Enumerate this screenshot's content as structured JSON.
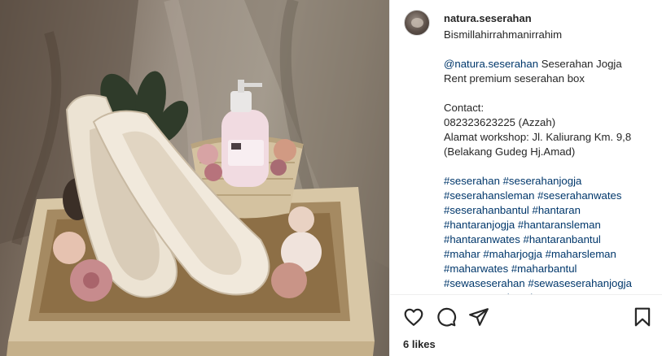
{
  "post": {
    "username": "natura.seserahan",
    "image_icon": "product-photo",
    "caption_lines": [
      {
        "text": "Bismillahirrahmanirrahim",
        "kind": "text"
      },
      {
        "text": "",
        "kind": "blank"
      },
      {
        "mention": "@natura.seserahan",
        "text": " Seserahan Jogja",
        "kind": "mention"
      },
      {
        "text": "Rent premium seserahan box",
        "kind": "text"
      },
      {
        "text": "",
        "kind": "blank"
      },
      {
        "text": "Contact:",
        "kind": "text"
      },
      {
        "text": "082323623225 (Azzah)",
        "kind": "text"
      },
      {
        "text": "Alamat workshop: Jl. Kaliurang Km. 9,8",
        "kind": "text"
      },
      {
        "text": "(Belakang Gudeg Hj.Amad)",
        "kind": "text"
      },
      {
        "text": "",
        "kind": "blank"
      },
      {
        "text": "#seserahan #seserahanjogja",
        "kind": "tag"
      },
      {
        "text": "#seserahansleman #seserahanwates",
        "kind": "tag"
      },
      {
        "text": "#seserahanbantul #hantaran",
        "kind": "tag"
      },
      {
        "text": "#hantaranjogja #hantaransleman",
        "kind": "tag"
      },
      {
        "text": "#hantaranwates #hantaranbantul",
        "kind": "tag"
      },
      {
        "text": "#mahar #maharjogja #maharsleman",
        "kind": "tag"
      },
      {
        "text": "#maharwates #maharbantul",
        "kind": "tag"
      },
      {
        "text": "#sewaseserahan #sewaseserahanjogja",
        "kind": "tag"
      },
      {
        "text": "#sewaseserahansleman",
        "kind": "tag"
      }
    ],
    "likes_text": "6 likes"
  },
  "actions": {
    "like_icon": "heart-icon",
    "comment_icon": "comment-icon",
    "share_icon": "share-icon",
    "save_icon": "bookmark-icon"
  },
  "colors": {
    "text": "#262626",
    "link": "#00376b",
    "divider": "#efefef"
  }
}
